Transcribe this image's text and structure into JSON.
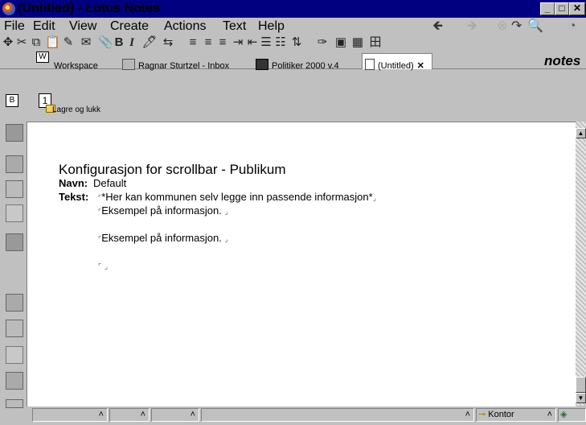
{
  "window": {
    "title": "(Untitled) - Lotus Notes"
  },
  "menu": {
    "file": "File",
    "edit": "Edit",
    "view": "View",
    "create": "Create",
    "actions": "Actions",
    "text": "Text",
    "help": "Help"
  },
  "toolbar": {
    "bold": "B",
    "italic": "I"
  },
  "tabs": {
    "workspace": "Workspace",
    "inbox": "Ragnar Sturtzel - Inbox",
    "politiker": "Politiker 2000 v.4",
    "untitled": "(Untitled)"
  },
  "brand": "notes",
  "actionbar": {
    "number": "1",
    "save_close": "Lagre og lukk",
    "nav_letter": "B"
  },
  "document": {
    "title": "Konfigurasjon for scrollbar - Publikum",
    "name_label": "Navn:",
    "name_value": "Default",
    "text_label": "Tekst:",
    "line1": "*Her kan kommunen selv legge inn passende informasjon*",
    "line2": "Eksempel på informasjon.",
    "line3": "Eksempel på informasjon."
  },
  "statusbar": {
    "location": "Kontor"
  }
}
